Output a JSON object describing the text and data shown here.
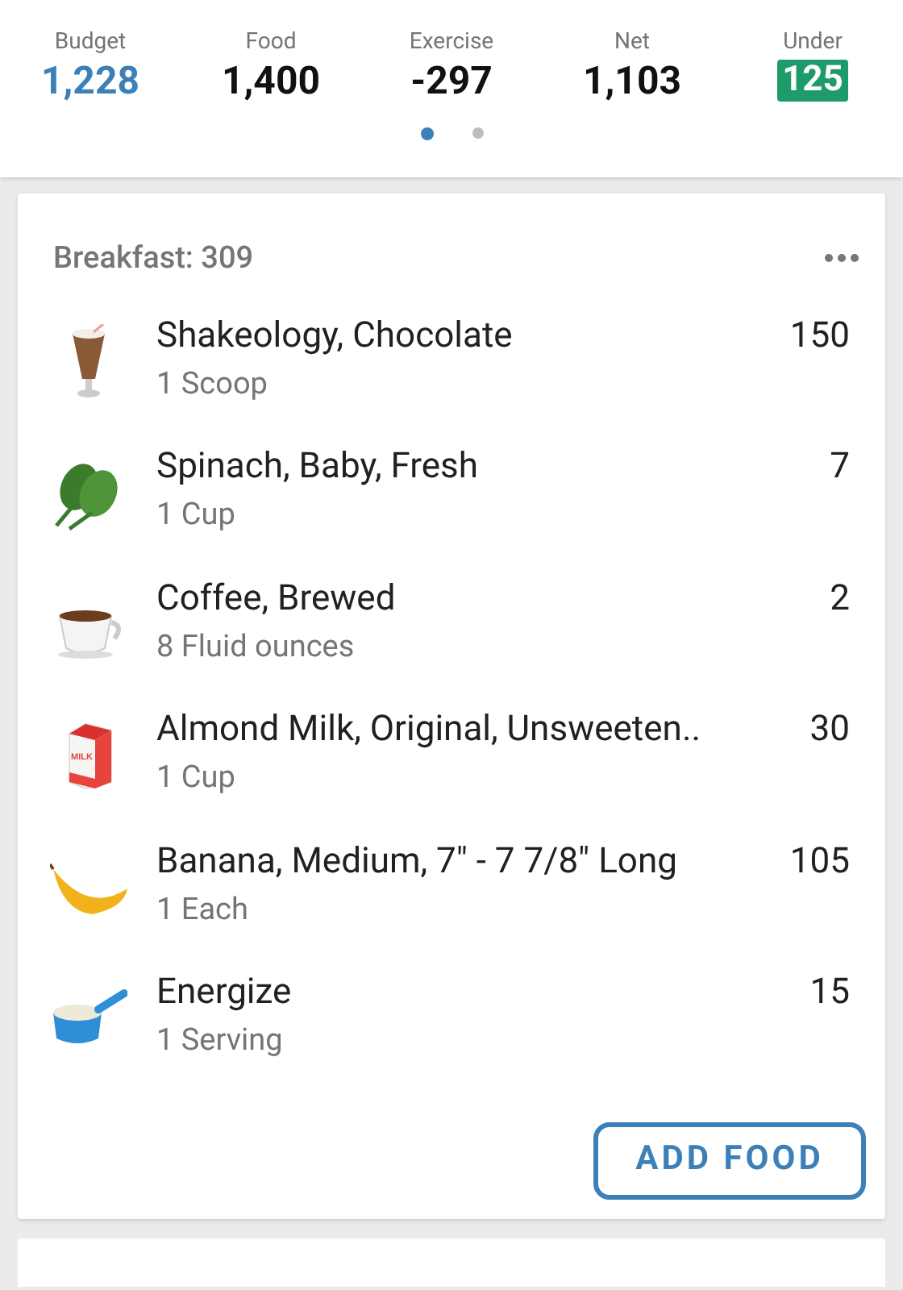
{
  "summary": [
    {
      "label": "Budget",
      "value": "1,228",
      "kind": "budget"
    },
    {
      "label": "Food",
      "value": "1,400",
      "kind": "plain"
    },
    {
      "label": "Exercise",
      "value": "-297",
      "kind": "plain"
    },
    {
      "label": "Net",
      "value": "1,103",
      "kind": "plain"
    },
    {
      "label": "Under",
      "value": "125",
      "kind": "badge"
    }
  ],
  "pages": [
    {
      "selected": true
    },
    {
      "selected": false
    }
  ],
  "meal": {
    "title": "Breakfast: 309",
    "items": [
      {
        "name": "Shakeology, Chocolate",
        "serving": "1 Scoop",
        "calories": "150",
        "kind": "shake"
      },
      {
        "name": "Spinach, Baby, Fresh",
        "serving": "1 Cup",
        "calories": "7",
        "kind": "spinach"
      },
      {
        "name": "Coffee, Brewed",
        "serving": "8 Fluid ounces",
        "calories": "2",
        "kind": "coffee"
      },
      {
        "name": "Almond Milk, Original, Unsweeten..",
        "serving": "1 Cup",
        "calories": "30",
        "kind": "milk",
        "icon_text": "MILK"
      },
      {
        "name": "Banana, Medium, 7\" - 7 7/8\" Long",
        "serving": "1 Each",
        "calories": "105",
        "kind": "banana"
      },
      {
        "name": "Energize",
        "serving": "1 Serving",
        "calories": "15",
        "kind": "scoop"
      }
    ],
    "button": "ADD FOOD"
  }
}
